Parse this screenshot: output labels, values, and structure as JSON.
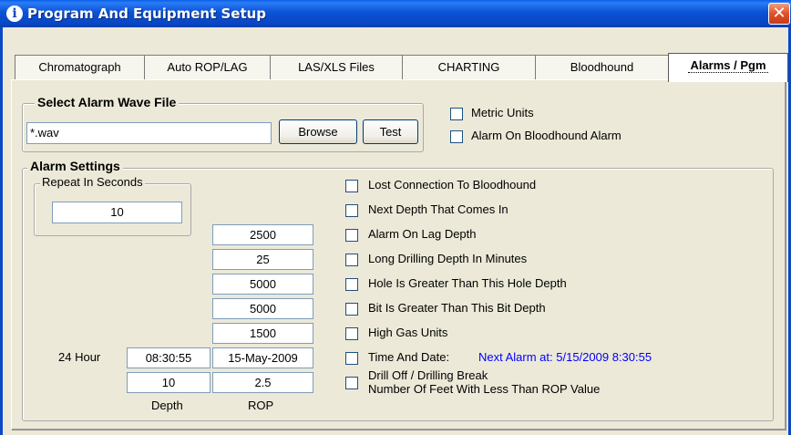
{
  "window": {
    "title": "Program And Equipment Setup",
    "title_icon": "info-icon",
    "close_glyph": "✕"
  },
  "tabs": [
    {
      "label": "Chromatograph",
      "active": false
    },
    {
      "label": "Auto ROP/LAG",
      "active": false
    },
    {
      "label": "LAS/XLS Files",
      "active": false
    },
    {
      "label": "CHARTING",
      "active": false
    },
    {
      "label": "Bloodhound",
      "active": false
    },
    {
      "label": "Alarms / Pgm",
      "active": true
    }
  ],
  "wave_file": {
    "group_title": "Select Alarm Wave File",
    "value": "*.wav",
    "browse_label": "Browse",
    "test_label": "Test"
  },
  "options": {
    "metric_units": {
      "label": "Metric Units",
      "checked": false
    },
    "alarm_on_bloodhound": {
      "label": "Alarm On Bloodhound Alarm",
      "checked": false
    }
  },
  "alarm_settings": {
    "group_title": "Alarm Settings",
    "repeat_title": "Repeat In Seconds",
    "repeat_value": "10",
    "values": [
      "2500",
      "25",
      "5000",
      "5000",
      "1500"
    ],
    "time_label": "24 Hour",
    "time_value": "08:30:55",
    "date_value": "15-May-2009",
    "depth_value": "10",
    "rop_value": "2.5",
    "depth_label": "Depth",
    "rop_label": "ROP",
    "checks": [
      {
        "label": "Lost Connection To Bloodhound",
        "checked": false
      },
      {
        "label": "Next Depth That Comes In",
        "checked": false
      },
      {
        "label": "Alarm On Lag Depth",
        "checked": false
      },
      {
        "label": "Long Drilling Depth In Minutes",
        "checked": false
      },
      {
        "label": "Hole Is Greater Than This Hole Depth",
        "checked": false
      },
      {
        "label": "Bit Is Greater Than This Bit Depth",
        "checked": false
      },
      {
        "label": "High Gas Units",
        "checked": false
      },
      {
        "label": "Time And Date:",
        "checked": false
      }
    ],
    "next_alarm": "Next Alarm at: 5/15/2009 8:30:55",
    "drill_off_line1": "Drill Off / Drilling Break",
    "drill_off_line2": "Number Of Feet With Less Than ROP Value"
  }
}
